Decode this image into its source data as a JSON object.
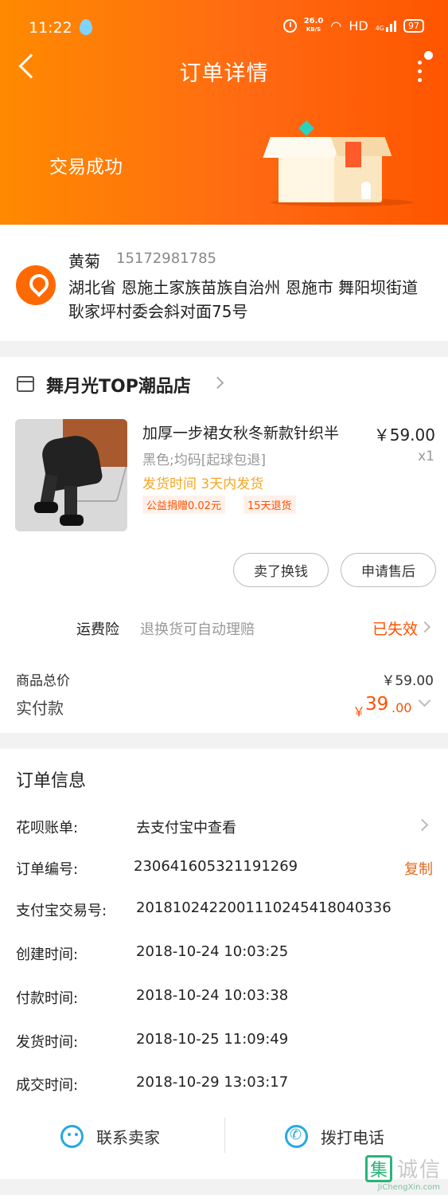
{
  "status_bar": {
    "time": "11:22",
    "net_speed": "26.0",
    "net_unit": "KB/S",
    "hd": "HD",
    "signal": "4G",
    "battery": "97"
  },
  "header": {
    "title": "订单详情",
    "trade_status": "交易成功"
  },
  "address": {
    "name": "黄菊",
    "phone": "15172981785",
    "detail": "湖北省 恩施土家族苗族自治州 恩施市 舞阳坝街道 耿家坪村委会斜对面75号"
  },
  "shop": {
    "name": "舞月光TOP潮品店"
  },
  "product": {
    "title": "加厚一步裙女秋冬新款针织半",
    "price": "￥59.00",
    "spec": "黑色;均码[起球包退]",
    "quantity": "x1",
    "ship_time": "发货时间 3天内发货",
    "tags": [
      "公益捐赠0.02元",
      "15天退货"
    ]
  },
  "actions": {
    "sell": "卖了换钱",
    "after_sale": "申请售后"
  },
  "insurance": {
    "label": "运费险",
    "desc": "退换货可自动理赔",
    "status": "已失效"
  },
  "summary": {
    "goods_total_label": "商品总价",
    "goods_total": "￥59.00",
    "paid_label": "实付款",
    "paid_yen": "￥",
    "paid_int": "39",
    "paid_dec": ".00"
  },
  "order_info": {
    "title": "订单信息",
    "rows": [
      {
        "label": "花呗账单:",
        "value": "去支付宝中查看"
      },
      {
        "label": "订单编号:",
        "value": "230641605321191269"
      },
      {
        "label": "支付宝交易号:",
        "value": "2018102422001110245418040336"
      },
      {
        "label": "创建时间:",
        "value": "2018-10-24 10:03:25"
      },
      {
        "label": "付款时间:",
        "value": "2018-10-24 10:03:38"
      },
      {
        "label": "发货时间:",
        "value": "2018-10-25 11:09:49"
      },
      {
        "label": "成交时间:",
        "value": "2018-10-29 13:03:17"
      }
    ],
    "copy_label": "复制"
  },
  "footer": {
    "contact_seller": "联系卖家",
    "call_phone": "拨打电话"
  },
  "watermark": {
    "text": "诚信",
    "logo": "集",
    "url": "JiChengXin.com"
  },
  "icons": [
    "back-icon",
    "more-icon",
    "location-pin-icon",
    "shop-icon",
    "chevron-right-icon",
    "chevron-down-icon",
    "chat-icon",
    "phone-icon"
  ],
  "colors": {
    "header_start": "#ff8a00",
    "header_end": "#ff5500",
    "accent": "#ff5000",
    "link": "#e06a1d",
    "ship_time": "#f5a623",
    "icon_blue": "#27a9e1"
  }
}
